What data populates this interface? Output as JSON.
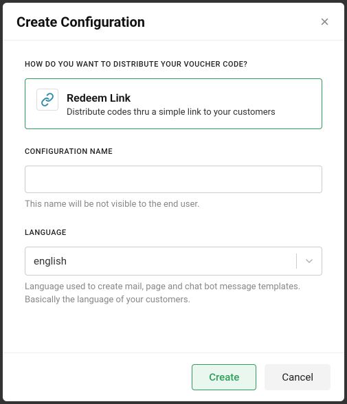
{
  "header": {
    "title": "Create Configuration"
  },
  "distribute": {
    "question": "HOW DO YOU WANT TO DISTRIBUTE YOUR VOUCHER CODE?",
    "option": {
      "title": "Redeem Link",
      "description": "Distribute codes thru a simple link to your customers",
      "icon_name": "link-icon"
    }
  },
  "config_name": {
    "label": "CONFIGURATION NAME",
    "value": "",
    "helper": "This name will be not visible to the end user."
  },
  "language": {
    "label": "LANGUAGE",
    "selected": "english",
    "helper": "Language used to create mail, page and chat bot message templates. Basically the language of your customers."
  },
  "footer": {
    "create_label": "Create",
    "cancel_label": "Cancel"
  },
  "colors": {
    "accent": "#2e9e5b"
  }
}
